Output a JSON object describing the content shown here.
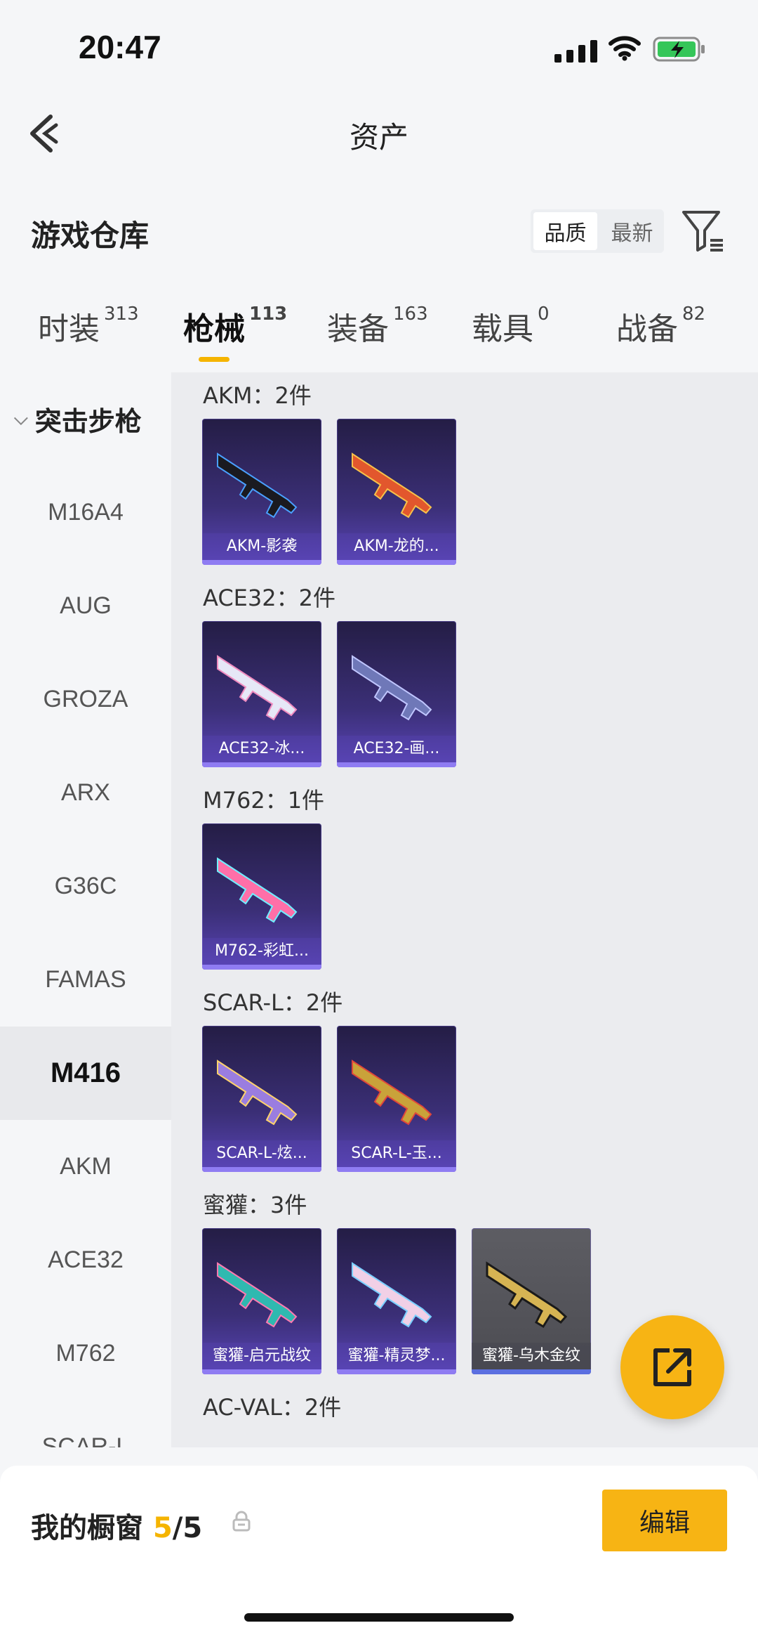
{
  "status": {
    "time": "20:47"
  },
  "header": {
    "title": "资产"
  },
  "warehouse": {
    "title": "游戏仓库",
    "sort_options": [
      "品质",
      "最新"
    ],
    "selected_sort": "品质"
  },
  "tabs": [
    {
      "label": "时装",
      "count": "313"
    },
    {
      "label": "枪械",
      "count": "113",
      "active": true
    },
    {
      "label": "装备",
      "count": "163"
    },
    {
      "label": "载具",
      "count": "0"
    },
    {
      "label": "战备",
      "count": "82"
    }
  ],
  "sidebar": {
    "category": "突击步枪",
    "items": [
      "M16A4",
      "AUG",
      "GROZA",
      "ARX",
      "G36C",
      "FAMAS",
      "M416",
      "AKM",
      "ACE32",
      "M762",
      "SCAR-L"
    ],
    "selected": "M416"
  },
  "groups": [
    {
      "title": "AKM：2件",
      "items": [
        "AKM-影袭",
        "AKM-龙的..."
      ]
    },
    {
      "title": "ACE32：2件",
      "items": [
        "ACE32-冰...",
        "ACE32-画..."
      ]
    },
    {
      "title": "M762：1件",
      "items": [
        "M762-彩虹..."
      ]
    },
    {
      "title": "SCAR-L：2件",
      "items": [
        "SCAR-L-炫...",
        "SCAR-L-玉..."
      ]
    },
    {
      "title": "蜜獾：3件",
      "items": [
        "蜜獾-启元战纹",
        "蜜獾-精灵梦...",
        "蜜獾-乌木金纹"
      ]
    },
    {
      "title": "AC-VAL：2件",
      "items": []
    }
  ],
  "bottom": {
    "label": "我的橱窗",
    "count_used": "5",
    "count_total": "/5",
    "edit_label": "编辑"
  }
}
